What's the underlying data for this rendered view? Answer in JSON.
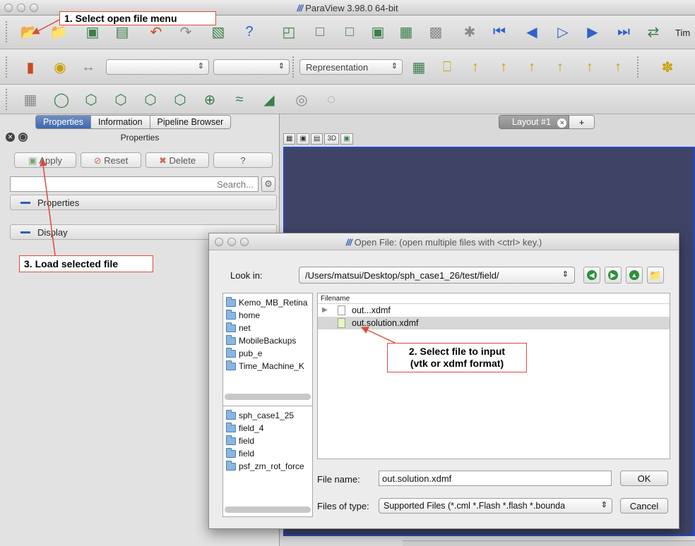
{
  "window": {
    "title": "ParaView 3.98.0 64-bit"
  },
  "toolbar2": {
    "representation_label": "Representation",
    "combo1_value": "",
    "combo2_value": ""
  },
  "toolbar1": {
    "time_label": "Tim"
  },
  "left_panel": {
    "tabs": [
      "Properties",
      "Information",
      "Pipeline Browser"
    ],
    "header_title": "Properties",
    "buttons": {
      "apply": "Apply",
      "reset": "Reset",
      "delete": "Delete",
      "help": "?"
    },
    "search_placeholder": "Search...",
    "sections": {
      "properties": "Properties",
      "display": "Display"
    }
  },
  "layout": {
    "tab_label": "Layout #1",
    "add_tab": "+",
    "view_3d": "3D"
  },
  "dialog": {
    "title": "Open File:  (open multiple files with <ctrl> key.)",
    "look_in_label": "Look in:",
    "look_in_path": "/Users/matsui/Desktop/sph_case1_26/test/field/",
    "favorites": [
      "Kemo_MB_Retina",
      "home",
      "net",
      "MobileBackups",
      "pub_e",
      "Time_Machine_K"
    ],
    "recent": [
      "sph_case1_25",
      "field_4",
      "field",
      "field",
      "psf_zm_rot_force"
    ],
    "file_header": "Filename",
    "files": [
      {
        "name": "out...xdmf",
        "selected": false
      },
      {
        "name": "out.solution.xdmf",
        "selected": true
      }
    ],
    "file_name_label": "File name:",
    "file_name_value": "out.solution.xdmf",
    "files_of_type_label": "Files of type:",
    "files_of_type_value": "Supported Files (*.cml  *.Flash *.flash  *.bounda",
    "ok_label": "OK",
    "cancel_label": "Cancel"
  },
  "annotations": {
    "step1": "1. Select open file menu",
    "step2_line1": "2. Select file to input",
    "step2_line2": "(vtk or xdmf format)",
    "step3": "3. Load selected file"
  },
  "colors": {
    "callout_border": "#d94c3e",
    "render_view": "#3f4466",
    "active_tab": "#3f67ad"
  }
}
